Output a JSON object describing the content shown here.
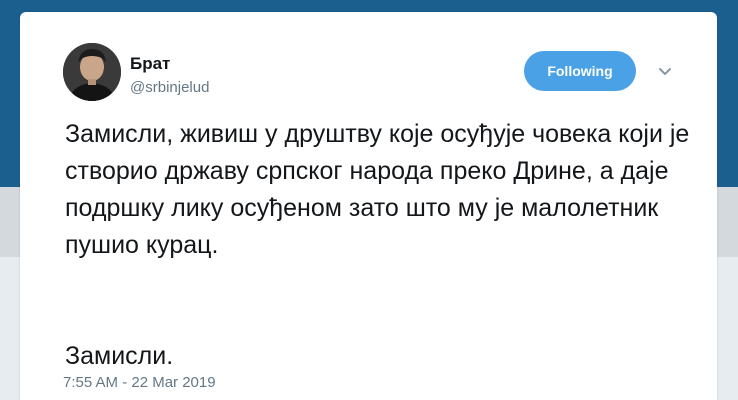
{
  "author": {
    "name": "Брат",
    "handle": "@srbinjelud"
  },
  "follow_button": {
    "label": "Following"
  },
  "tweet": {
    "text": "Замисли, живиш у друштву које осуђује човека који је створио државу српског народа преко Дрине, а даје подршку лику осуђеном зато што му је малолетник пушио курац.",
    "closing": "Замисли.",
    "timestamp": "7:55 AM - 22 Mar 2019"
  },
  "icons": {
    "menu": "chevron-down-icon"
  },
  "colors": {
    "header_bg": "#1b5f8f",
    "button_bg": "#4aa1e6",
    "text_primary": "#14171a",
    "text_secondary": "#657786"
  }
}
